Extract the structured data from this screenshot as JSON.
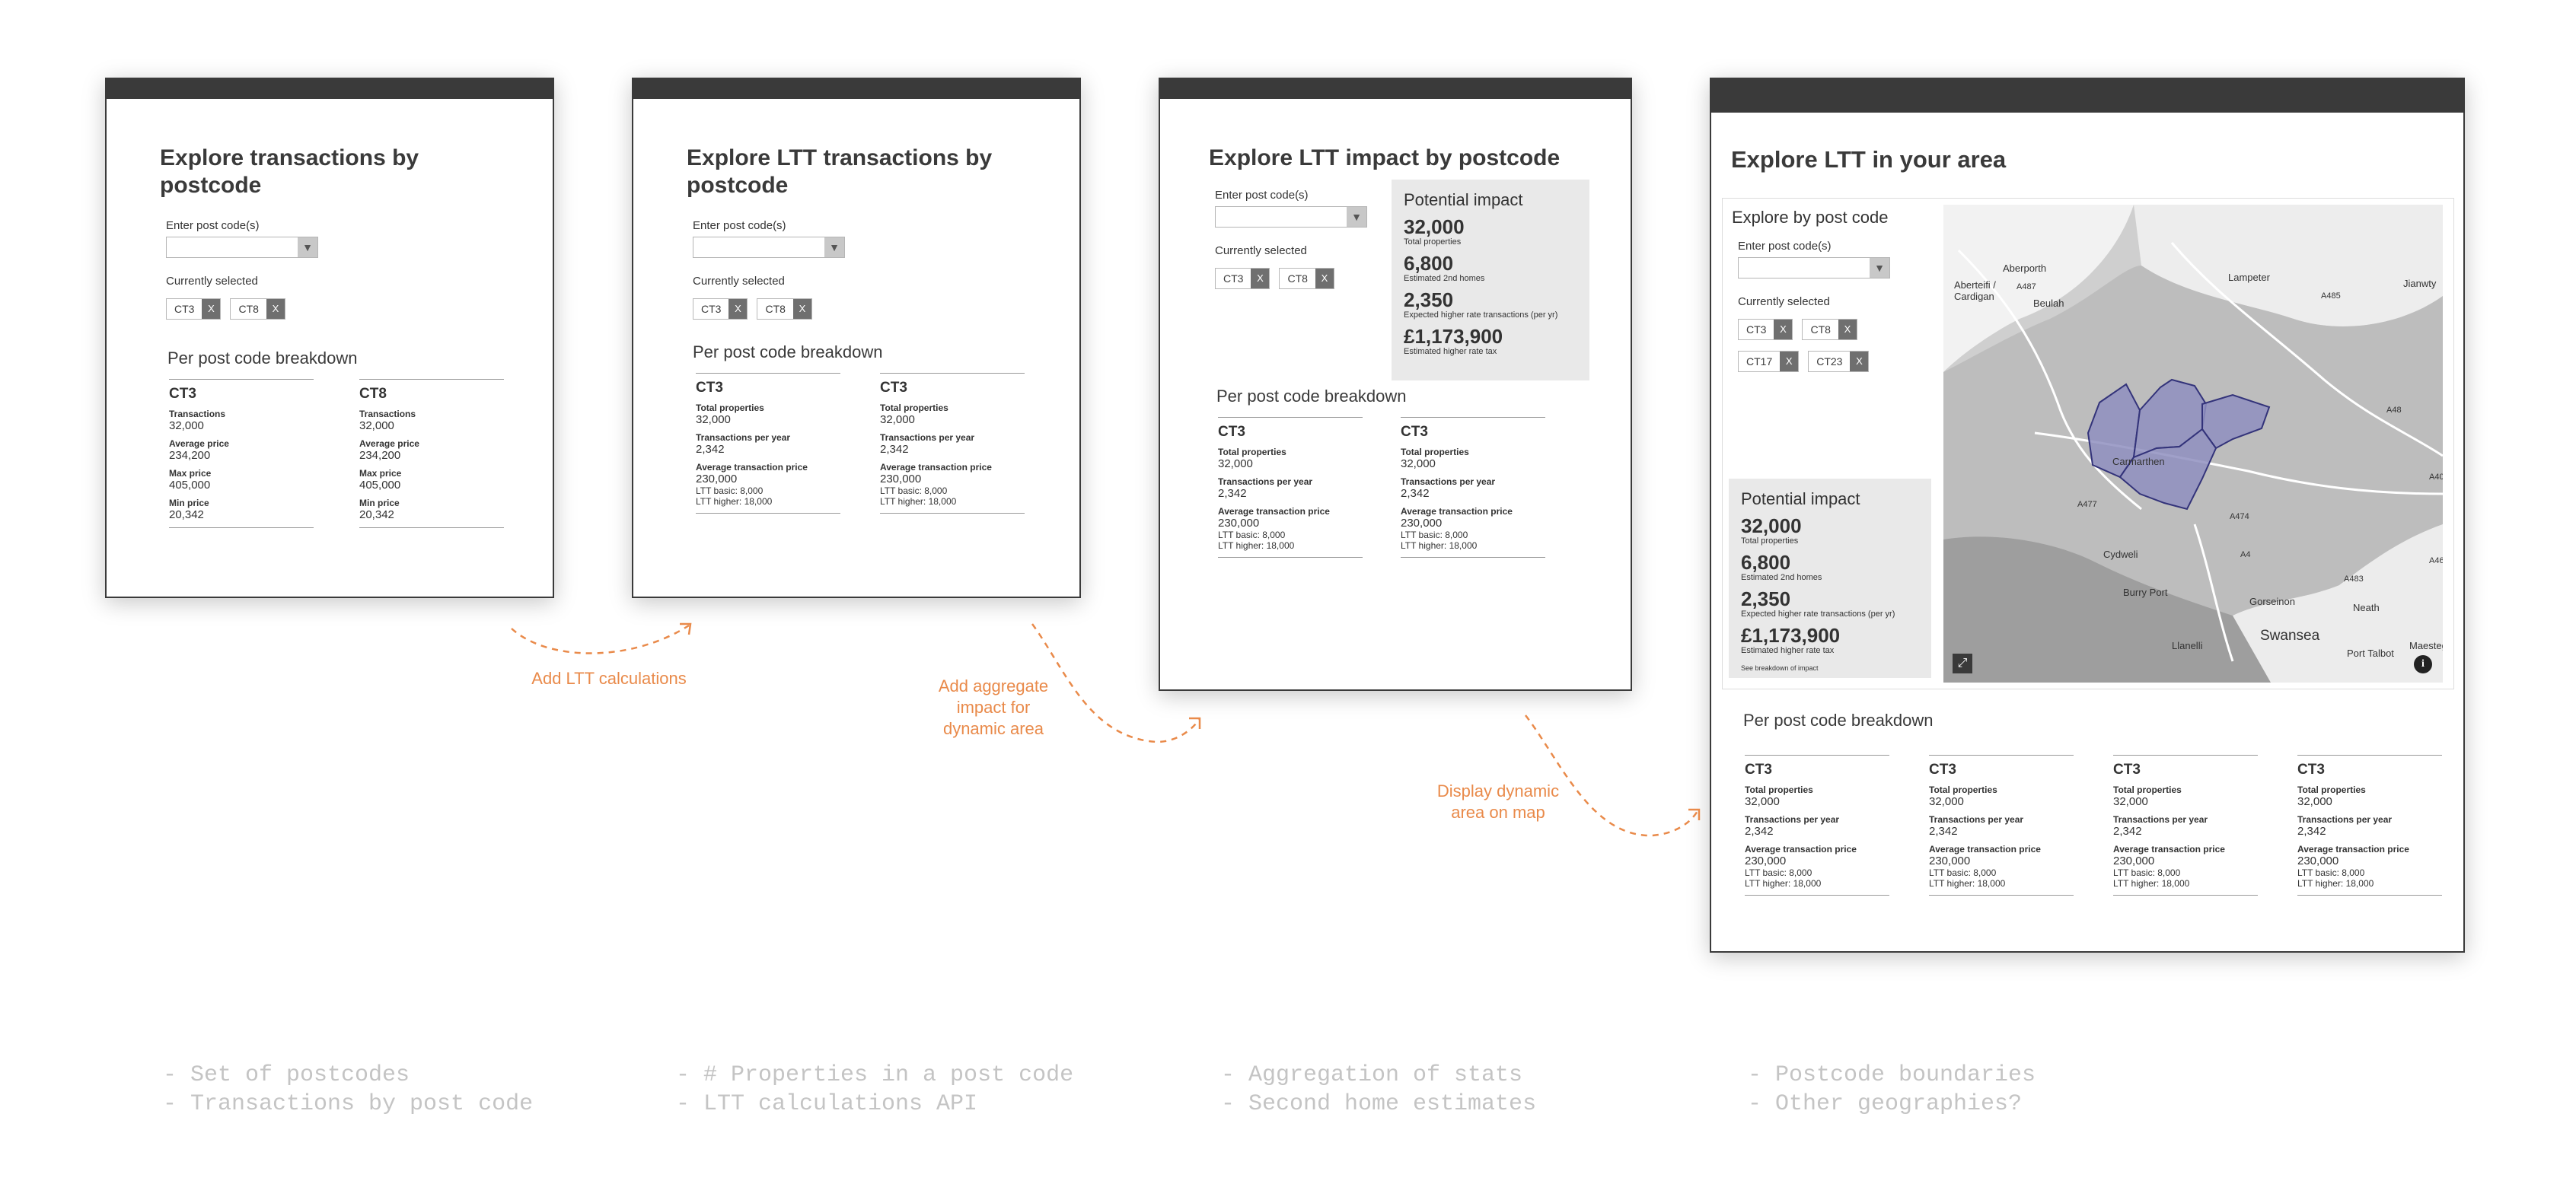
{
  "accent_color": "#e98a4a",
  "common": {
    "enter_label": "Enter post code(s)",
    "selected_label": "Currently selected",
    "remove_symbol": "X",
    "dropdown_icon": "triangle-down-icon",
    "breakdown_title": "Per post code breakdown",
    "k_total_properties": "Total properties",
    "k_transactions_per_year": "Transactions per year",
    "k_avg_transaction_price": "Average transaction price",
    "total_properties": "32,000",
    "transactions_per_year": "2,342",
    "avg_transaction_price": "230,000",
    "ltt_basic": "LTT basic: 8,000",
    "ltt_higher": "LTT higher: 18,000"
  },
  "impact": {
    "title": "Potential impact",
    "total_properties": "32,000",
    "total_properties_label": "Total properties",
    "second_homes": "6,800",
    "second_homes_label": "Estimated 2nd homes",
    "higher_rate": "2,350",
    "higher_rate_label": "Expected higher rate transactions (per yr)",
    "tax": "£1,173,900",
    "tax_label": "Estimated higher rate tax",
    "see_breakdown": "See breakdown of impact"
  },
  "panel1": {
    "title": "Explore transactions by postcode",
    "chips": [
      "CT3",
      "CT8"
    ],
    "columns": [
      {
        "code": "CT3",
        "k1": "Transactions",
        "v1": "32,000",
        "k2": "Average price",
        "v2": "234,200",
        "k3": "Max price",
        "v3": "405,000",
        "k4": "Min price",
        "v4": "20,342"
      },
      {
        "code": "CT8",
        "k1": "Transactions",
        "v1": "32,000",
        "k2": "Average price",
        "v2": "234,200",
        "k3": "Max price",
        "v3": "405,000",
        "k4": "Min price",
        "v4": "20,342"
      }
    ]
  },
  "panel2": {
    "title": "Explore LTT transactions by postcode",
    "chips": [
      "CT3",
      "CT8"
    ],
    "column_codes": [
      "CT3",
      "CT3"
    ]
  },
  "panel3": {
    "title": "Explore LTT impact by postcode",
    "chips": [
      "CT3",
      "CT8"
    ],
    "column_codes": [
      "CT3",
      "CT3"
    ]
  },
  "panel4": {
    "title": "Explore LTT in your area",
    "explore_label": "Explore by post code",
    "chips": [
      "CT3",
      "CT8",
      "CT17",
      "CT23"
    ],
    "column_codes": [
      "CT3",
      "CT3",
      "CT3",
      "CT3"
    ],
    "map_places": [
      "Aberporth",
      "Aberteifi / Cardigan",
      "Beulah",
      "Lampeter",
      "Jianwty",
      "Carmarthen",
      "Cydweli",
      "Burry Port",
      "Swansea",
      "Neath",
      "Port Talbot",
      "Gorseinon",
      "Llanelli",
      "Maesteg"
    ],
    "map_roads": [
      "A487",
      "A485",
      "A477",
      "A48",
      "A4",
      "A483",
      "A40",
      "A474",
      "A465"
    ]
  },
  "notes": {
    "note1": "Add LTT calculations",
    "note2": [
      "Add aggregate",
      "impact for",
      "dynamic area"
    ],
    "note3": [
      "Display dynamic",
      "area on map"
    ]
  },
  "footer": {
    "col1": [
      "- Set of postcodes",
      "- Transactions by post code"
    ],
    "col2": [
      "- # Properties in a post code",
      "- LTT calculations API"
    ],
    "col3": [
      "- Aggregation of stats",
      "- Second home estimates"
    ],
    "col4": [
      "- Postcode boundaries",
      "- Other geographies?"
    ]
  }
}
